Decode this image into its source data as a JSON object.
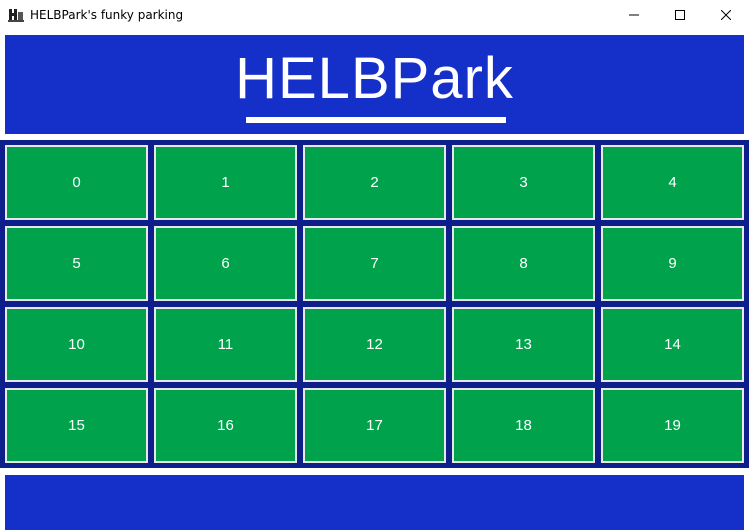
{
  "window": {
    "title": "HELBPark's funky parking"
  },
  "header": {
    "logo": "HELBPark"
  },
  "spots": [
    "0",
    "1",
    "2",
    "3",
    "4",
    "5",
    "6",
    "7",
    "8",
    "9",
    "10",
    "11",
    "12",
    "13",
    "14",
    "15",
    "16",
    "17",
    "18",
    "19"
  ],
  "colors": {
    "header_bg": "#1530c8",
    "grid_bg": "#0d1f8a",
    "spot_free": "#00a34c",
    "spot_border": "#e8e8e8"
  }
}
